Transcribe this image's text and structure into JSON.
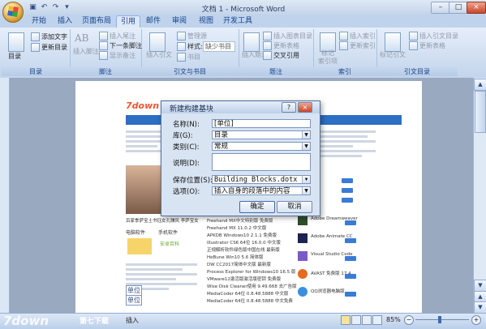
{
  "window": {
    "title": "文档 1 - Microsoft Word"
  },
  "qat": {
    "save_icon": "save-icon",
    "undo_icon": "undo-icon",
    "redo_icon": "redo-icon",
    "more_icon": "chevron-down-icon"
  },
  "tabs": [
    "开始",
    "插入",
    "页面布局",
    "引用",
    "邮件",
    "审阅",
    "视图",
    "开发工具"
  ],
  "ribbon": {
    "toc": {
      "big": "目录",
      "add_text": "添加文字",
      "update": "更新目录",
      "group": "目录"
    },
    "footnote": {
      "insert": "插入脚注",
      "insert_endnote": "插入尾注",
      "next": "下一条脚注",
      "show": "显示备注",
      "group": "脚注",
      "ab_icon": "AB"
    },
    "citations": {
      "insert_citation": "插入引文",
      "manage": "管理源",
      "style_label": "样式:",
      "style_value": "缺少书目",
      "bibliography": "书目",
      "group": "引文与书目"
    },
    "captions": {
      "insert_caption": "插入题注",
      "insert_table_figures": "插入图表目录",
      "update_table": "更新表格",
      "cross_ref": "交叉引用",
      "group": "题注"
    },
    "index": {
      "mark_entry": "标记",
      "mark_entry2": "索引项",
      "insert_index": "插入索引",
      "update_index": "更新索引",
      "group": "索引"
    },
    "toa": {
      "mark_citation": "标记引文",
      "insert_toa": "插入引文目录",
      "update_toa": "更新表格",
      "group": "引文目录"
    }
  },
  "document": {
    "site_logo": "7down",
    "caption": "百家季萨宝土书钰女孔赚风 李萨宝女",
    "list_items": [
      "Freehand MX中文特别版 免费版",
      "Freehand MX 11.0.2 中文版",
      "APKDB Windows10 2.1.1 免费版",
      "Illustrator CS6 64位 16.0.0 中文版",
      "正规解析软件绿色版中国在线 最新版",
      "HeBune Win10 5.6 简体版",
      "DW CC2017简体中文版 最新版",
      "Process Explorer for Windows10 16.5 版",
      "VMware12激活版激活版密钥 免费版",
      "Wise Disk Cleaner使用 9.49.668 去广告版",
      "MediaCoder 64位 0.8.48.5888 中文版",
      "MediaCoder 64位 0.8.48.5888 中文免费"
    ],
    "right_items": [
      "Adobe Dreamweaver",
      "Adobe Animate CC",
      "Visual Studio Code",
      "AVAST 免费版 17.4",
      "QQ浏览器电脑版"
    ],
    "download_label": "下载",
    "side_tags": [
      "电脑软件",
      "手机软件",
      "安卓百科"
    ],
    "autotext_tag": "单位",
    "autotext_tag2": "单位"
  },
  "dialog": {
    "title": "新建构建基块",
    "help": "?",
    "close": "×",
    "name_label": "名称(N):",
    "name_value": "[单位]",
    "gallery_label": "库(G):",
    "gallery_value": "目录",
    "category_label": "类别(C):",
    "category_value": "常规",
    "desc_label": "说明(D):",
    "desc_value": "",
    "save_label": "保存位置(S):",
    "save_value": "Building Blocks.dotx",
    "options_label": "选项(O):",
    "options_value": "插入自身的段落中的内容",
    "ok": "确定",
    "cancel": "取消"
  },
  "statusbar": {
    "mode": "插入",
    "zoom": "85%",
    "watermark": "第七下载"
  },
  "colors": {
    "ribbon": "#cddcf0",
    "accent": "#15428b",
    "doc_bg": "#99a9c0"
  }
}
